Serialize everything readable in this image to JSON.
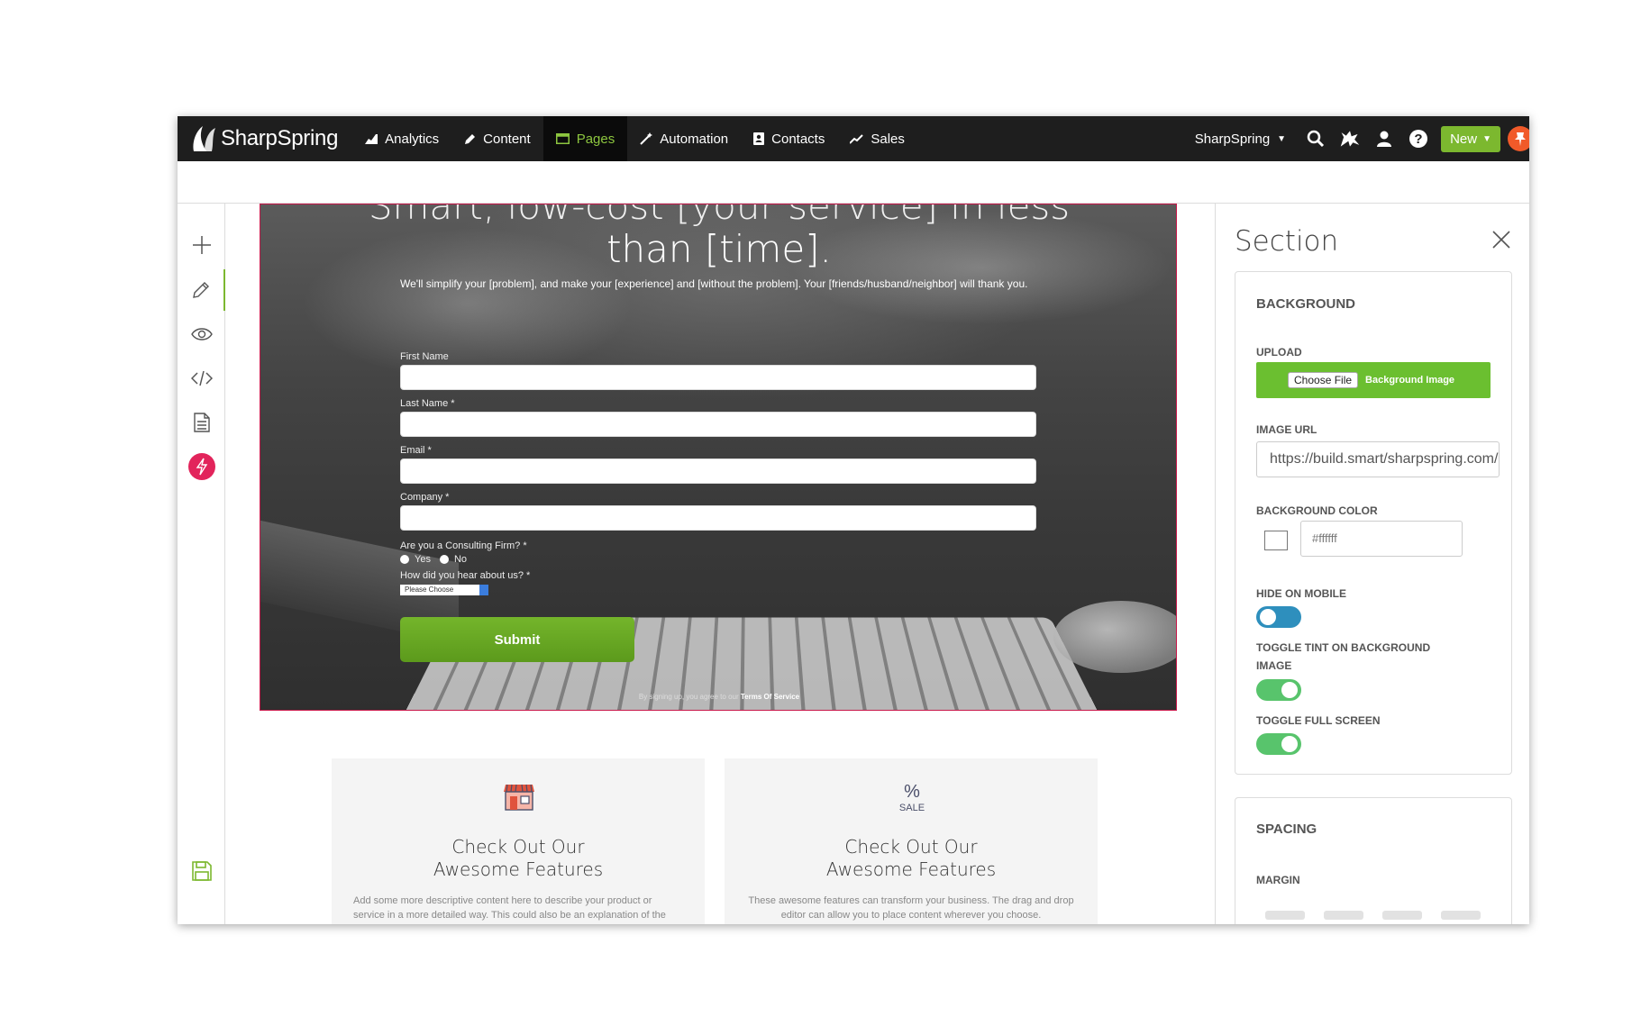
{
  "topnav": {
    "logo_text": "SharpSpring",
    "items": [
      {
        "label": "Analytics",
        "icon": "analytics-icon"
      },
      {
        "label": "Content",
        "icon": "pencil-icon"
      },
      {
        "label": "Pages",
        "icon": "window-icon",
        "active": true
      },
      {
        "label": "Automation",
        "icon": "wand-icon"
      },
      {
        "label": "Contacts",
        "icon": "contact-book-icon"
      },
      {
        "label": "Sales",
        "icon": "trend-icon"
      }
    ],
    "account_label": "SharpSpring",
    "new_label": "New",
    "active_color": "#8dc63f",
    "new_color": "#7cb82f"
  },
  "hero": {
    "title_line1": "Smart, low-cost [your service] in less",
    "title_line2": "than [time].",
    "subtitle": "We'll simplify your [problem], and make your [experience] and [without the problem]. Your [friends/husband/neighbor] will thank you.",
    "fields": [
      {
        "label": "First Name"
      },
      {
        "label": "Last Name *"
      },
      {
        "label": "Email *"
      },
      {
        "label": "Company *"
      }
    ],
    "radio_question": "Are you a Consulting Firm? *",
    "radio_yes": "Yes",
    "radio_no": "No",
    "select_question": "How did you hear about us? *",
    "select_value": "Please Choose",
    "submit_label": "Submit",
    "terms_prefix": "By signing up, you agree to our",
    "terms_link": "Terms Of Service"
  },
  "features": [
    {
      "icon": "storefront-icon",
      "title_line1": "Check Out Our",
      "title_line2": "Awesome Features",
      "desc": "Add some more descriptive content here to describe your product or service in a more detailed way. This could also be an explanation of the details of your offer if you are running a"
    },
    {
      "icon": "sale-icon",
      "title_line1": "Check Out Our",
      "title_line2": "Awesome Features",
      "desc": "These awesome features can transform your business. The drag and drop editor can allow you to place content wherever you choose."
    }
  ],
  "panel": {
    "title": "Section",
    "background": {
      "heading": "BACKGROUND",
      "upload_label": "UPLOAD",
      "choose_file": "Choose File",
      "upload_button_text": "Background Image",
      "image_url_label": "IMAGE URL",
      "image_url_value": "https://build.smart/sharpspring.com/",
      "bg_color_label": "BACKGROUND COLOR",
      "bg_color_value": "#ffffff",
      "hide_mobile_label": "HIDE ON MOBILE",
      "hide_mobile_on": false,
      "tint_label_line1": "TOGGLE TINT ON BACKGROUND",
      "tint_label_line2": "IMAGE",
      "tint_on": true,
      "fullscreen_label": "TOGGLE FULL SCREEN",
      "fullscreen_on": true
    },
    "spacing": {
      "heading": "SPACING",
      "margin_label": "MARGIN"
    }
  },
  "left_tools": [
    "plus-icon",
    "pencil-icon",
    "eye-icon",
    "code-icon",
    "document-icon",
    "lightning-icon",
    "save-icon"
  ]
}
